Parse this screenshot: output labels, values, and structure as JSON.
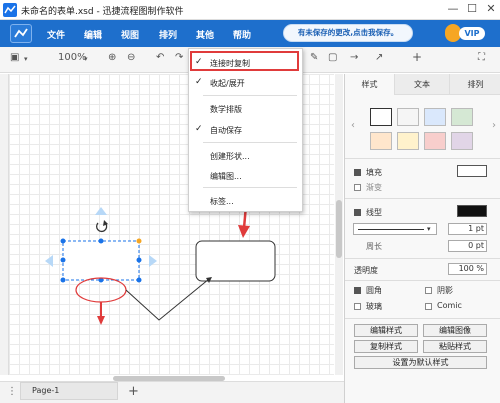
{
  "window": {
    "title": "未命名的表单.xsd - 迅捷流程图制作软件",
    "min": "—",
    "max": "☐",
    "close": "✕"
  },
  "menu": {
    "items": [
      "文件",
      "编辑",
      "视图",
      "排列",
      "其他",
      "帮助"
    ],
    "notice": "有未保存的更改,点击我保存。",
    "vip": "VIP"
  },
  "toolbar": {
    "zoom": "100%"
  },
  "dropdown": {
    "items": [
      {
        "label": "连接时复制",
        "checked": true
      },
      {
        "label": "收起/展开",
        "checked": true
      },
      {
        "label": "数学排版",
        "checked": false
      },
      {
        "label": "自动保存",
        "checked": true
      },
      {
        "label": "创建形状...",
        "checked": false
      },
      {
        "label": "编辑图...",
        "checked": false
      },
      {
        "label": "标签...",
        "checked": false
      }
    ],
    "check_mark": "✓"
  },
  "panel": {
    "tabs": [
      "样式",
      "文本",
      "排列"
    ],
    "fill_label": "填充",
    "gradient_label": "渐变",
    "line_label": "线型",
    "line_width": "1 pt",
    "perimeter_label": "周长",
    "perimeter_value": "0 pt",
    "opacity_label": "透明度",
    "opacity_value": "100 %",
    "rounded": "圆角",
    "shadow": "阴影",
    "glass": "玻璃",
    "comic": "Comic",
    "btn_edit_style": "编辑样式",
    "btn_edit_image": "编辑图像",
    "btn_copy_style": "复制样式",
    "btn_paste_style": "粘贴样式",
    "btn_default_style": "设置为默认样式",
    "swatch_colors": [
      "#ffffff",
      "#f5f5f5",
      "#dae8fc",
      "#d5e8d4",
      "#ffe6cc",
      "#fff2cc",
      "#f8cecc",
      "#e1d5e7"
    ]
  },
  "bottom": {
    "page": "Page-1",
    "add": "+",
    "more": "⋮"
  },
  "colors": {
    "accent": "#1e6fcc",
    "highlight": "#e03b3b",
    "selection": "#1a73e8"
  }
}
